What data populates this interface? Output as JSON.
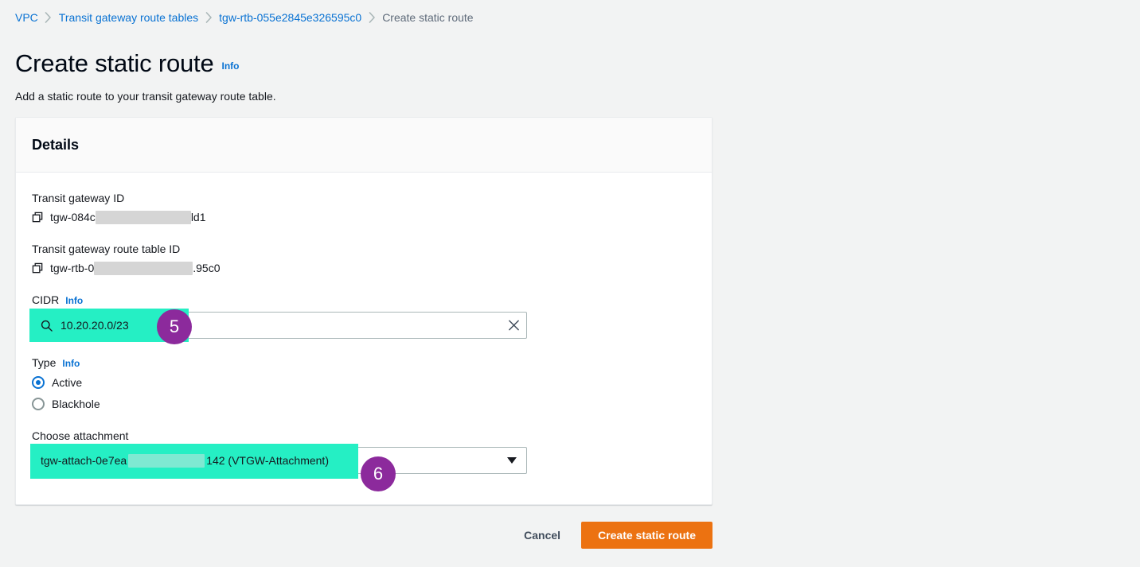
{
  "breadcrumb": {
    "items": [
      {
        "label": "VPC",
        "current": false
      },
      {
        "label": "Transit gateway route tables",
        "current": false
      },
      {
        "label": "tgw-rtb-055e2845e326595c0",
        "current": false
      },
      {
        "label": "Create static route",
        "current": true
      }
    ]
  },
  "header": {
    "title": "Create static route",
    "info_label": "Info",
    "subtitle": "Add a static route to your transit gateway route table."
  },
  "card": {
    "title": "Details",
    "transit_gateway": {
      "label": "Transit gateway ID",
      "value_prefix": "tgw-084c",
      "value_suffix": "ld1",
      "copy_icon": "copy-icon"
    },
    "route_table": {
      "label": "Transit gateway route table ID",
      "value_prefix": "tgw-rtb-0",
      "value_suffix": ".95c0",
      "copy_icon": "copy-icon"
    },
    "cidr": {
      "label": "CIDR",
      "info_label": "Info",
      "value": "10.20.20.0/23",
      "search_icon": "search-icon",
      "clear_icon": "close-icon"
    },
    "type": {
      "label": "Type",
      "info_label": "Info",
      "options": [
        {
          "label": "Active",
          "selected": true
        },
        {
          "label": "Blackhole",
          "selected": false
        }
      ]
    },
    "attachment": {
      "label": "Choose attachment",
      "value_prefix": "tgw-attach-0e7ea",
      "value_suffix": "142 (VTGW-Attachment)",
      "caret_icon": "chevron-down-icon"
    }
  },
  "footer": {
    "cancel_label": "Cancel",
    "submit_label": "Create static route"
  },
  "annotations": {
    "step_cidr": "5",
    "step_attachment": "6"
  },
  "colors": {
    "link": "#0972d3",
    "primary_button": "#ec7211",
    "highlight": "#25efc4",
    "badge": "#8c2a9c",
    "page_background": "#f2f3f3"
  }
}
